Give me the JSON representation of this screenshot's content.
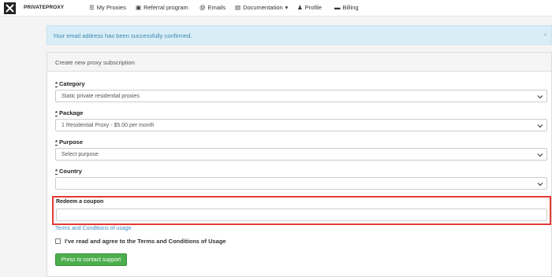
{
  "navbar": {
    "brand": "PRIVATEPROXY",
    "items": [
      {
        "label": "My Proxies",
        "icon": "list-icon",
        "glyph": "☰"
      },
      {
        "label": "Referral program",
        "icon": "video-icon",
        "glyph": "▣"
      },
      {
        "label": "Emails",
        "icon": "at-icon",
        "glyph": "@"
      },
      {
        "label": "Documentation",
        "icon": "book-icon",
        "glyph": "▤"
      },
      {
        "label": "Profile",
        "icon": "user-icon",
        "glyph": "♟"
      },
      {
        "label": "Billing",
        "icon": "card-icon",
        "glyph": "▬"
      }
    ]
  },
  "alert": {
    "message": "Your email address has been successfully confirmed.",
    "close": "×"
  },
  "panel": {
    "title": "Create new proxy subscription"
  },
  "form": {
    "required_mark": "*",
    "category": {
      "label": "Category",
      "value": "Static private residential proxies"
    },
    "package": {
      "label": "Package",
      "value": "1 Residential Proxy - $5.00 per month"
    },
    "purpose": {
      "label": "Purpose",
      "value": "Select purpose"
    },
    "country": {
      "label": "Country",
      "value": ""
    },
    "coupon": {
      "label": "Redeem a coupon",
      "value": ""
    },
    "terms_link": "Terms and Conditions of usage",
    "agree_text": "I've read and agree to the Terms and Conditions of Usage",
    "support_button": "Press to contact support"
  },
  "colors": {
    "alert_bg": "#d9edf7",
    "alert_text": "#3a87ad",
    "highlight_border": "#e53935",
    "button_green": "#4cae4c",
    "link_blue": "#3f8fc5"
  }
}
